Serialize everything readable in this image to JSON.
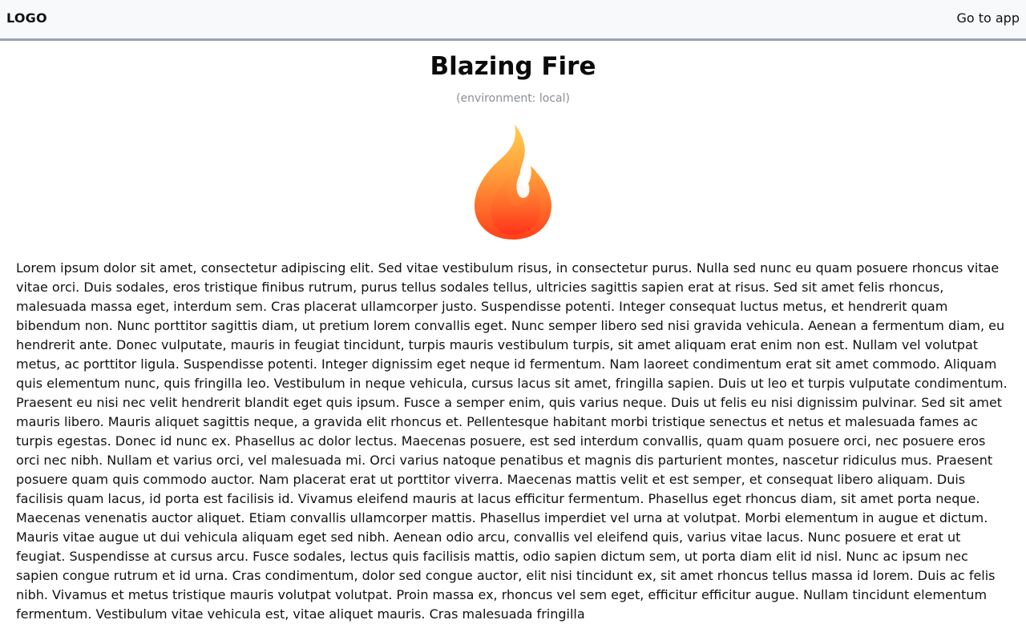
{
  "header": {
    "logo": "LOGO",
    "go_to_app": "Go to app"
  },
  "hero": {
    "title": "Blazing Fire",
    "environment": "(environment: local)",
    "flame_icon": "flame-icon"
  },
  "body": {
    "paragraph": "Lorem ipsum dolor sit amet, consectetur adipiscing elit. Sed vitae vestibulum risus, in consectetur purus. Nulla sed nunc eu quam posuere rhoncus vitae vitae orci. Duis sodales, eros tristique finibus rutrum, purus tellus sodales tellus, ultricies sagittis sapien erat at risus. Sed sit amet felis rhoncus, malesuada massa eget, interdum sem. Cras placerat ullamcorper justo. Suspendisse potenti. Integer consequat luctus metus, et hendrerit quam bibendum non. Nunc porttitor sagittis diam, ut pretium lorem convallis eget. Nunc semper libero sed nisi gravida vehicula. Aenean a fermentum diam, eu hendrerit ante. Donec vulputate, mauris in feugiat tincidunt, turpis mauris vestibulum turpis, sit amet aliquam erat enim non est. Nullam vel volutpat metus, ac porttitor ligula. Suspendisse potenti. Integer dignissim eget neque id fermentum. Nam laoreet condimentum erat sit amet commodo. Aliquam quis elementum nunc, quis fringilla leo. Vestibulum in neque vehicula, cursus lacus sit amet, fringilla sapien. Duis ut leo et turpis vulputate condimentum. Praesent eu nisi nec velit hendrerit blandit eget quis ipsum. Fusce a semper enim, quis varius neque. Duis ut felis eu nisi dignissim pulvinar. Sed sit amet mauris libero. Mauris aliquet sagittis neque, a gravida elit rhoncus et. Pellentesque habitant morbi tristique senectus et netus et malesuada fames ac turpis egestas. Donec id nunc ex. Phasellus ac dolor lectus. Maecenas posuere, est sed interdum convallis, quam quam posuere orci, nec posuere eros orci nec nibh. Nullam et varius orci, vel malesuada mi. Orci varius natoque penatibus et magnis dis parturient montes, nascetur ridiculus mus. Praesent posuere quam quis commodo auctor. Nam placerat erat ut porttitor viverra. Maecenas mattis velit et est semper, et consequat libero aliquam. Duis facilisis quam lacus, id porta est facilisis id. Vivamus eleifend mauris at lacus efficitur fermentum. Phasellus eget rhoncus diam, sit amet porta neque. Maecenas venenatis auctor aliquet. Etiam convallis ullamcorper mattis. Phasellus imperdiet vel urna at volutpat. Morbi elementum in augue et dictum. Mauris vitae augue ut dui vehicula aliquam eget sed nibh. Aenean odio arcu, convallis vel eleifend quis, varius vitae lacus. Nunc posuere et erat ut feugiat. Suspendisse at cursus arcu. Fusce sodales, lectus quis facilisis mattis, odio sapien dictum sem, ut porta diam elit id nisl. Nunc ac ipsum nec sapien congue rutrum et id urna. Cras condimentum, dolor sed congue auctor, elit nisi tincidunt ex, sit amet rhoncus tellus massa id lorem. Duis ac felis nibh. Vivamus et metus tristique mauris volutpat volutpat. Proin massa ex, rhoncus vel sem eget, efficitur efficitur augue. Nullam tincidunt elementum fermentum. Vestibulum vitae vehicula est, vitae aliquet mauris. Cras malesuada fringilla"
  },
  "colors": {
    "header_bg": "#f8f9fb",
    "header_border": "#94a3b8",
    "flame_outer_top": "#ffd04f",
    "flame_outer_bottom": "#ff4b1f",
    "flame_inner_top": "#ffb347",
    "flame_inner_bottom": "#ff5a1f",
    "muted_text": "#8a8f98"
  }
}
